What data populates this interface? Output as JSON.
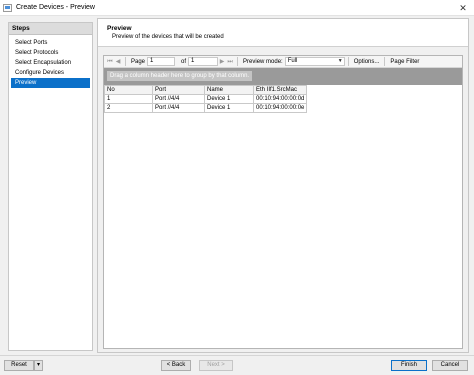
{
  "window": {
    "title": "Create Devices - Preview",
    "close_glyph": "✕"
  },
  "sidebar": {
    "header": "Steps",
    "items": [
      {
        "label": "Select Ports",
        "active": false
      },
      {
        "label": "Select Protocols",
        "active": false
      },
      {
        "label": "Select Encapsulation",
        "active": false
      },
      {
        "label": "Configure Devices",
        "active": false
      },
      {
        "label": "Preview",
        "active": true
      }
    ]
  },
  "main": {
    "title": "Preview",
    "subtitle": "Preview of the devices that will be created"
  },
  "toolbar": {
    "first_glyph": "⏮",
    "prev_glyph": "◀",
    "page_label": "Page",
    "page_value": "1",
    "of_label": "of",
    "total_pages": "1",
    "next_glyph": "▶",
    "last_glyph": "⏭",
    "mode_label": "Preview mode:",
    "mode_value": "Full",
    "dropdown_glyph": "▼",
    "options_label": "Options...",
    "filter_label": "Page Filter"
  },
  "grid": {
    "group_hint": "Drag a column header here to group by that column.",
    "columns": [
      "No",
      "Port",
      "Name",
      "Eth IIf1.SrcMac"
    ],
    "rows": [
      [
        "1",
        "Port //4/4",
        "Device 1",
        "00:10:94:00:00:0d"
      ],
      [
        "2",
        "Port //4/4",
        "Device 1",
        "00:10:94:00:00:0e"
      ]
    ]
  },
  "footer": {
    "reset_label": "Reset",
    "reset_arrow": "▾",
    "back_label": "< Back",
    "next_label": "Next >",
    "finish_label": "Finish",
    "cancel_label": "Cancel"
  }
}
